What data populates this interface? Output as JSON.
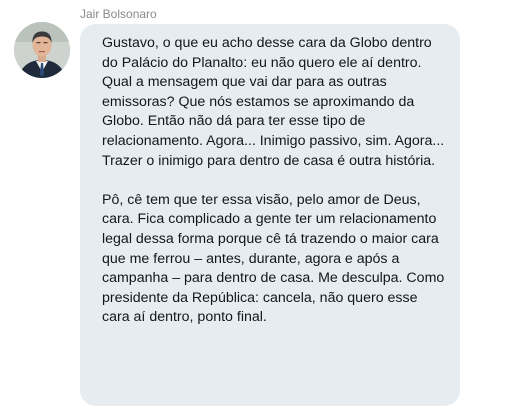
{
  "message": {
    "sender": "Jair Bolsonaro",
    "avatar_icon": "profile-photo",
    "bubble_color": "#e6ecf0",
    "paragraphs": [
      "Gustavo, o que eu acho desse cara da Globo dentro do Palácio do Planalto: eu não quero ele aí dentro. Qual a mensagem que vai dar para as outras emissoras? Que nós estamos se aproximando da Globo. Então não dá para ter esse tipo de relacionamento. Agora... Inimigo passivo, sim. Agora... Trazer o inimigo para dentro de casa é outra história.",
      "Pô, cê tem que ter essa visão, pelo amor de Deus, cara. Fica complicado a gente ter um relacionamento legal dessa forma porque cê tá trazendo o maior cara que me ferrou – antes, durante, agora e após a campanha – para dentro de casa. Me desculpa. Como presidente da República: cancela, não quero esse cara aí dentro, ponto final."
    ]
  }
}
